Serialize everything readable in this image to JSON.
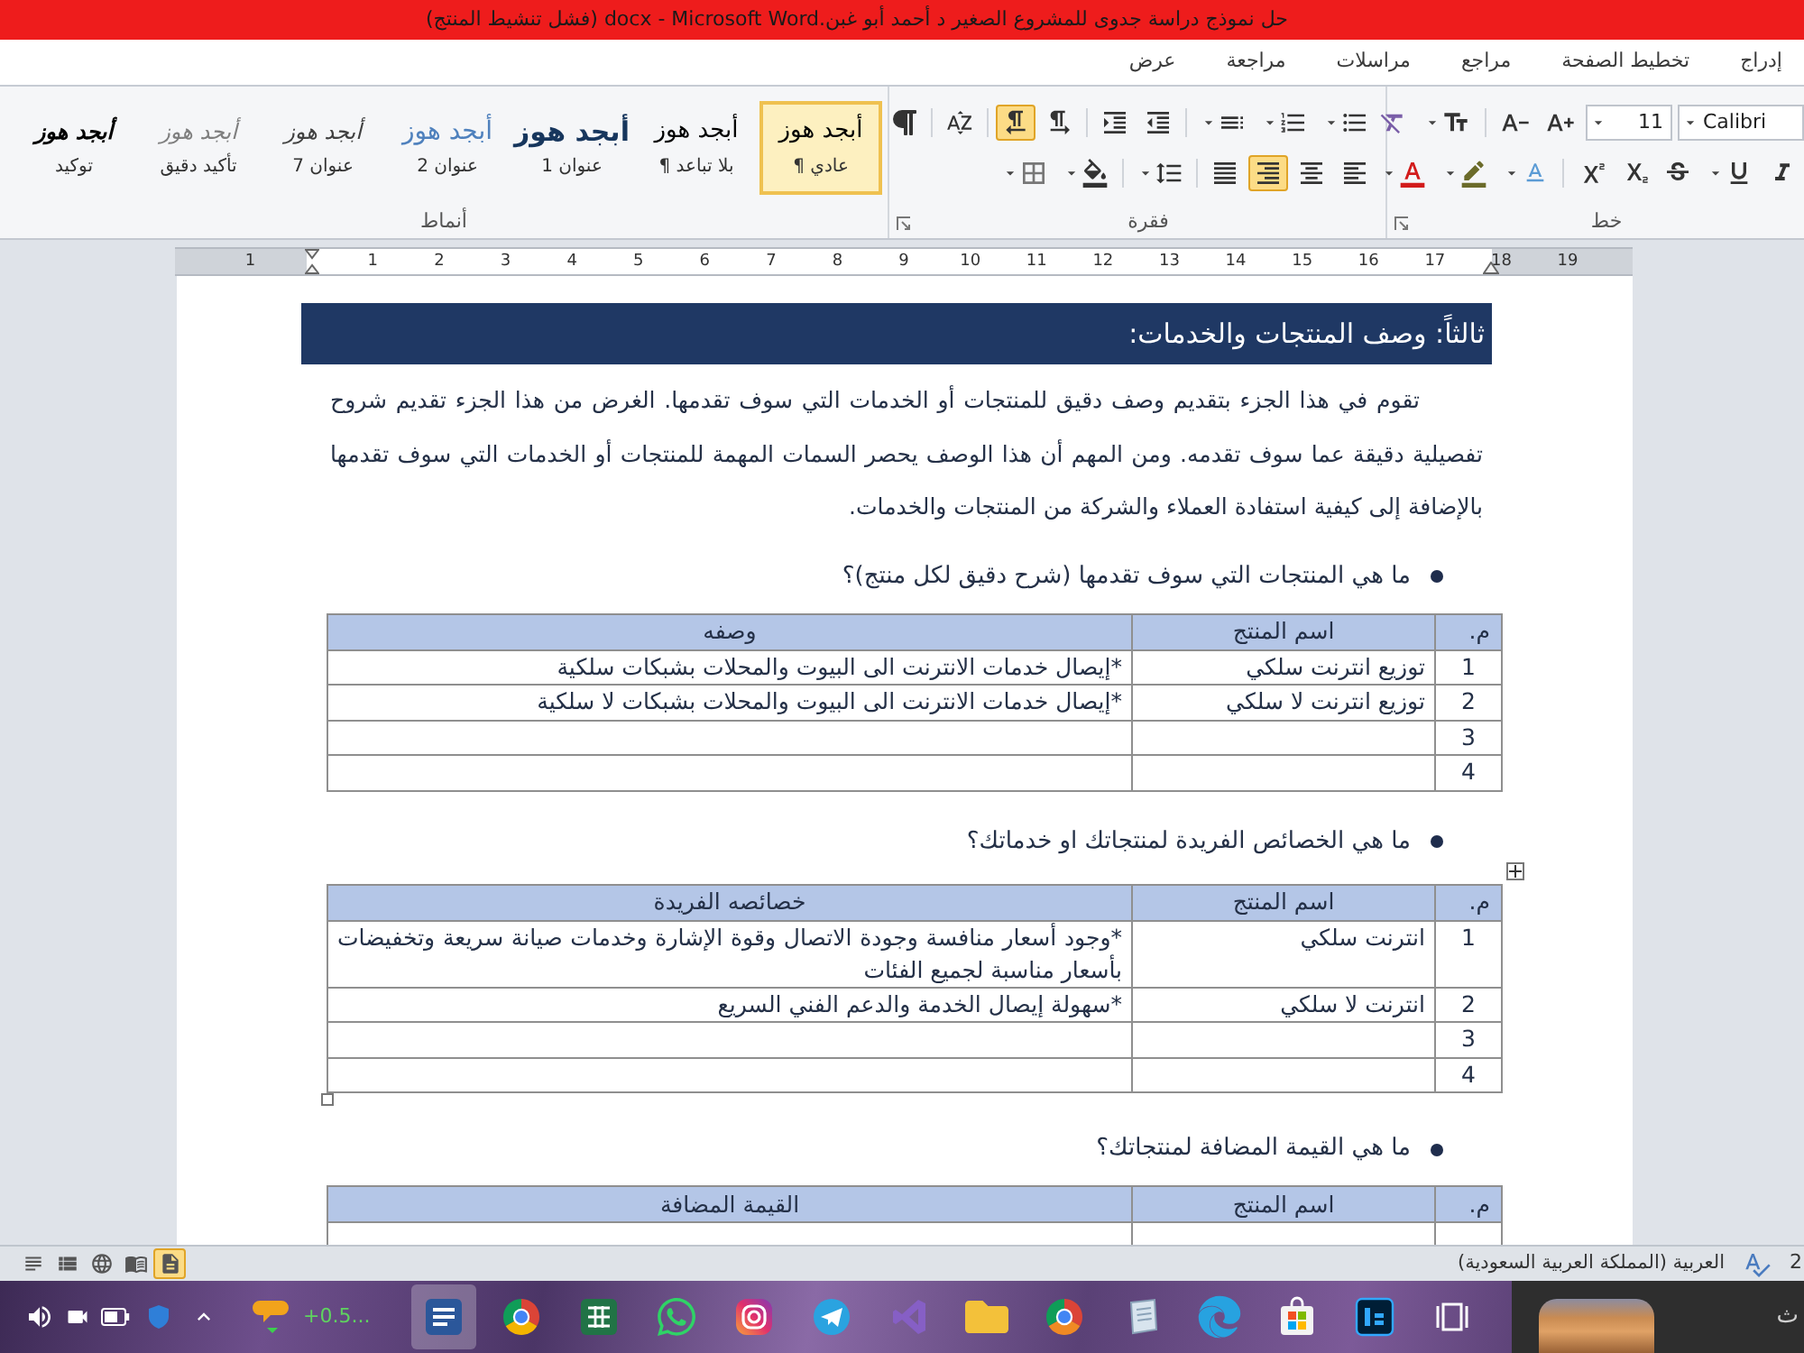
{
  "window": {
    "title": "حل نموذج دراسة جدوى للمشروع الصغير د أحمد  أبو غبن.docx  -  Microsoft Word (فشل تنشيط المنتج)"
  },
  "menu_tabs": [
    "إدراج",
    "تخطيط الصفحة",
    "مراجع",
    "مراسلات",
    "مراجعة",
    "عرض"
  ],
  "ribbon": {
    "font_group": {
      "label": "خط",
      "font_name": "Calibri",
      "font_size": "11"
    },
    "paragraph_group": {
      "label": "فقرة",
      "direction_buttons": [
        {
          "kind": "ltr",
          "on": false
        },
        {
          "kind": "rtl",
          "on": true
        }
      ],
      "align_buttons": [
        {
          "kind": "left",
          "on": false
        },
        {
          "kind": "center",
          "on": false
        },
        {
          "kind": "right",
          "on": true
        },
        {
          "kind": "justify",
          "on": false
        }
      ]
    },
    "styles_group": {
      "label": "أنماط",
      "styles": [
        {
          "kind": "normal",
          "sample": "أبجد هوز",
          "label": "عادي ¶",
          "selected": true
        },
        {
          "kind": "plain",
          "sample": "أبجد هوز",
          "label": "بلا تباعد ¶",
          "selected": false
        },
        {
          "kind": "heading1",
          "sample": "أبجد هوز",
          "label": "عنوان 1",
          "selected": false
        },
        {
          "kind": "heading2",
          "sample": "أبجد هوز",
          "label": "عنوان 2",
          "selected": false
        },
        {
          "kind": "heading7",
          "sample": "أبجد هوز",
          "label": "عنوان 7",
          "selected": false
        },
        {
          "kind": "subtle",
          "sample": "أبجد هوز",
          "label": "تأكيد دقيق",
          "selected": false
        },
        {
          "kind": "emphasis",
          "sample": "أبجد هوز",
          "label": "توكيد",
          "selected": false
        }
      ]
    }
  },
  "ruler": {
    "marks": [
      "19",
      "18",
      "17",
      "16",
      "15",
      "14",
      "13",
      "12",
      "11",
      "10",
      "9",
      "8",
      "7",
      "6",
      "5",
      "4",
      "3",
      "2",
      "1",
      "1"
    ]
  },
  "document": {
    "heading": "ثالثاً: وصف المنتجات والخدمات:",
    "paragraph": "تقوم في هذا الجزء بتقديم وصف دقيق للمنتجات أو الخدمات التي سوف تقدمها. الغرض من هذا الجزء تقديم شروح تفصيلية دقيقة عما سوف تقدمه. ومن المهم أن هذا الوصف يحصر السمات المهمة للمنتجات أو الخدمات التي سوف تقدمها بالإضافة إلى كيفية استفادة العملاء والشركة من المنتجات والخدمات.",
    "sections": [
      {
        "question": "ما هي المنتجات التي سوف تقدمها (شرح دقيق لكل منتج)؟",
        "handles": false,
        "cut_off": false,
        "columns": [
          "م.",
          "اسم المنتج",
          "وصفه"
        ],
        "rows": [
          [
            "1",
            "توزيع انترنت سلكي",
            "*إيصال خدمات الانترنت الى البيوت والمحلات بشبكات سلكية"
          ],
          [
            "2",
            "توزيع انترنت لا سلكي",
            "*إيصال خدمات الانترنت الى البيوت والمحلات بشبكات لا سلكية"
          ],
          [
            "3"
          ],
          [
            "4"
          ]
        ]
      },
      {
        "question": "ما هي الخصائص الفريدة لمنتجاتك او خدماتك؟",
        "handles": true,
        "cut_off": false,
        "columns": [
          "م.",
          "اسم المنتج",
          "خصائصه الفريدة"
        ],
        "rows": [
          [
            "1",
            "انترنت سلكي",
            "*وجود أسعار منافسة وجودة الاتصال وقوة الإشارة وخدمات صيانة سريعة وتخفيضات بأسعار مناسبة لجميع الفئات"
          ],
          [
            "2",
            "انترنت لا سلكي",
            "*سهولة إيصال الخدمة والدعم الفني السريع"
          ],
          [
            "3"
          ],
          [
            "4"
          ]
        ]
      },
      {
        "question": "ما هي القيمة المضافة لمنتجاتك؟",
        "handles": false,
        "cut_off": true,
        "columns": [
          "م.",
          "اسم المنتج",
          "القيمة المضافة"
        ]
      }
    ]
  },
  "status_bar": {
    "view_buttons": [
      {
        "kind": "draft",
        "selected": false
      },
      {
        "kind": "outline",
        "selected": false
      },
      {
        "kind": "web",
        "selected": false
      },
      {
        "kind": "reading",
        "selected": false
      },
      {
        "kind": "print",
        "selected": true
      }
    ],
    "language": "العربية (المملكة العربية السعودية)",
    "edge_text": "2"
  },
  "taskbar": {
    "widget_text": "+0.5...",
    "apps": [
      {
        "kind": "word",
        "active": true
      },
      {
        "kind": "chrome",
        "active": false
      },
      {
        "kind": "excel",
        "active": false
      },
      {
        "kind": "whatsapp",
        "active": false
      },
      {
        "kind": "instagram",
        "active": false
      },
      {
        "kind": "telegram",
        "active": false
      },
      {
        "kind": "vs",
        "active": false
      },
      {
        "kind": "explorer",
        "active": false
      },
      {
        "kind": "chrome_alt",
        "active": false
      },
      {
        "kind": "page",
        "active": false
      },
      {
        "kind": "edge",
        "active": false
      },
      {
        "kind": "store",
        "active": false
      },
      {
        "kind": "ps",
        "active": false
      },
      {
        "kind": "taskview",
        "active": false
      }
    ],
    "edge_text": "ث"
  }
}
